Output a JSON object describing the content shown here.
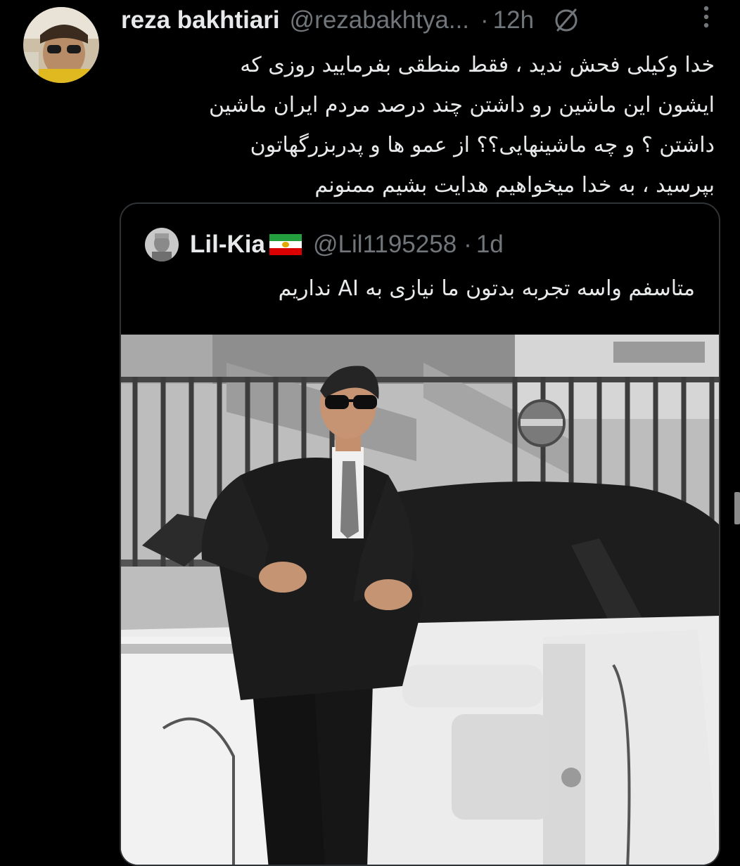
{
  "tweet": {
    "author_name": "reza bakhtiari",
    "author_handle": "@rezabakhtya...",
    "separator": "·",
    "time": "12h",
    "avatar_icon": "profile-photo-avatar",
    "text_lines": [
      "خدا وکیلی فحش ندید ، فقط منطقی بفرمایید روزی که",
      "ایشون این ماشین رو داشتن چند درصد مردم ایران ماشین",
      "داشتن ؟ و چه ماشینهایی؟؟  از عمو ها و پدربزرگهاتون",
      "بپرسید ، به خدا میخواهیم هدایت بشیم  ممنونم"
    ]
  },
  "quoted": {
    "author_name": "Lil-Kia",
    "author_handle": "@Lil1195258",
    "separator": "·",
    "time": "1d",
    "flag_icon": "iran-lion-and-sun-flag",
    "text": "متاسفم واسه تجربه بدتون ما نیازی به AI نداریم",
    "image_icon": "photo-man-in-suit-with-white-convertible"
  },
  "colors": {
    "background": "#000000",
    "text_primary": "#e7e9ea",
    "text_secondary": "#71767b",
    "border": "#2f3336"
  }
}
